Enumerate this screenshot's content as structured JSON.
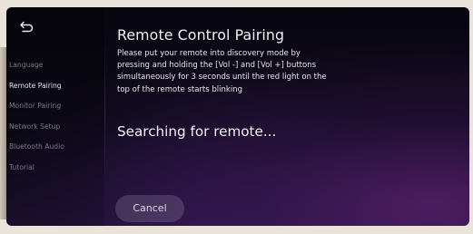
{
  "header": {
    "back_icon": "back-arrow-icon"
  },
  "sidebar": {
    "items": [
      {
        "label": "Language",
        "active": false
      },
      {
        "label": "Remote Pairing",
        "active": true
      },
      {
        "label": "Monitor Pairing",
        "active": false
      },
      {
        "label": "Network Setup",
        "active": false
      },
      {
        "label": "Bluetooth Audio",
        "active": false
      },
      {
        "label": "Tutorial",
        "active": false
      }
    ]
  },
  "main": {
    "title": "Remote Control Pairing",
    "description_lines": [
      "Please put your remote into discovery mode by",
      "pressing and holding the [Vol -] and [Vol +] buttons",
      "simultaneously for 3 seconds until the red light on the",
      "top of the remote starts blinking"
    ],
    "status": "Searching for remote...",
    "cancel_label": "Cancel"
  },
  "colors": {
    "background_top": "#08060f",
    "background_glow": "#782c8c",
    "text_primary": "#f2f0f6",
    "text_muted": "#7a7888"
  }
}
